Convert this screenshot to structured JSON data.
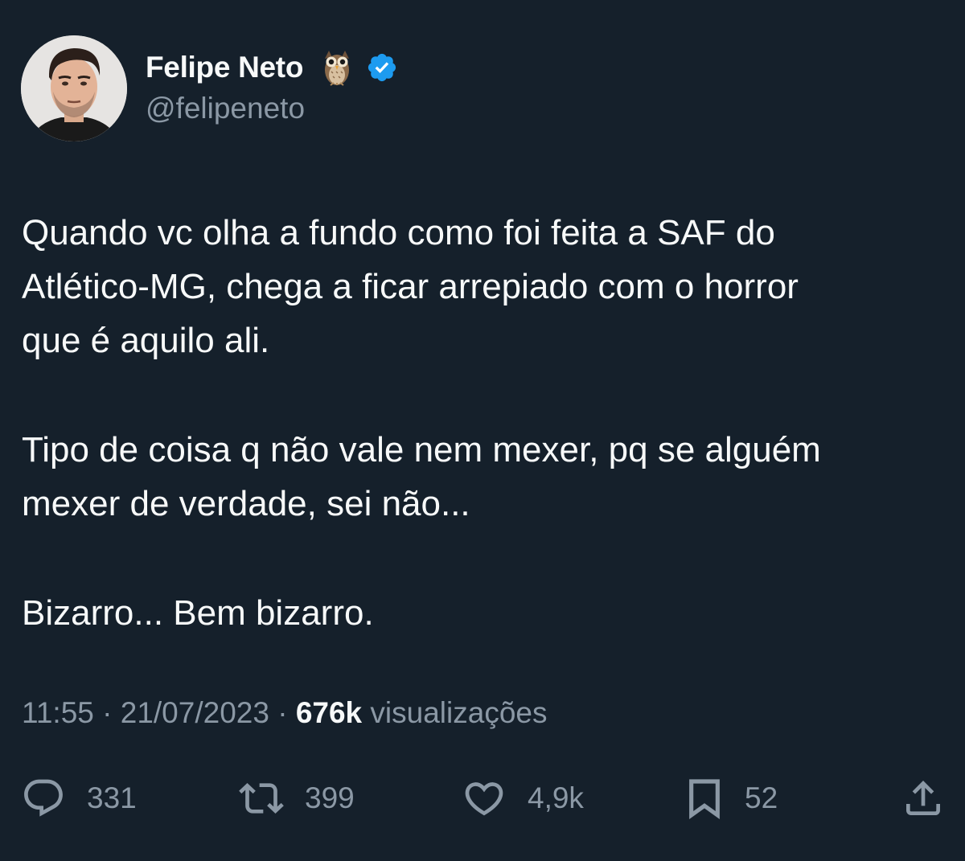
{
  "author": {
    "display_name": "Felipe Neto",
    "handle": "@felipeneto",
    "name_emoji": "owl-emoji",
    "verified_color": "#1d9bf0"
  },
  "tweet": {
    "paragraphs": [
      "Quando vc olha a fundo como foi feita a SAF do\nAtlético-MG, chega a ficar arrepiado com o horror\nque é aquilo ali.",
      "Tipo de coisa q não vale nem mexer, pq se alguém\nmexer de verdade, sei não...",
      "Bizarro... Bem bizarro."
    ]
  },
  "meta": {
    "time": "11:55",
    "separator1": " · ",
    "date": "21/07/2023",
    "separator2": " · ",
    "views_count": "676k",
    "views_label": " visualizações"
  },
  "actions": {
    "replies": "331",
    "retweets": "399",
    "likes": "4,9k",
    "bookmarks": "52"
  },
  "colors": {
    "background": "#15202b",
    "primary_text": "#f7f9f9",
    "secondary_text": "#8b98a5"
  }
}
